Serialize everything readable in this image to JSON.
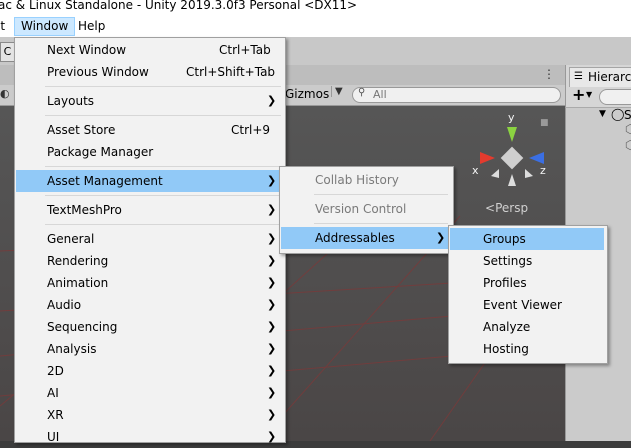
{
  "window": {
    "title": "ac & Linux Standalone - Unity 2019.3.0f3 Personal <DX11>"
  },
  "menubar": {
    "items": [
      {
        "label": "it"
      },
      {
        "label": "Window"
      },
      {
        "label": "Help"
      }
    ]
  },
  "toolbar": {
    "tool_glyph": "C"
  },
  "scene_view": {
    "gizmos_label": "Gizmos",
    "search_placeholder": "All",
    "persp_label": "Persp",
    "axis_x": "x",
    "axis_y": "y",
    "axis_z": "z",
    "colors": {
      "x_axis": "#e33b2e",
      "y_axis": "#8bd341",
      "z_axis": "#3b6fe3",
      "grid": "#7a3a3a"
    }
  },
  "hierarchy": {
    "tab_label": "Hierarch",
    "add_label": "+",
    "scene_initial": "S"
  },
  "window_menu": {
    "items": [
      {
        "label": "Next Window",
        "shortcut": "Ctrl+Tab"
      },
      {
        "label": "Previous Window",
        "shortcut": "Ctrl+Shift+Tab"
      },
      {
        "label": "Layouts",
        "submenu": true
      },
      {
        "label": "Asset Store",
        "shortcut": "Ctrl+9"
      },
      {
        "label": "Package Manager"
      },
      {
        "label": "Asset Management",
        "submenu": true,
        "highlighted": true
      },
      {
        "label": "TextMeshPro",
        "submenu": true
      },
      {
        "label": "General",
        "submenu": true
      },
      {
        "label": "Rendering",
        "submenu": true
      },
      {
        "label": "Animation",
        "submenu": true
      },
      {
        "label": "Audio",
        "submenu": true
      },
      {
        "label": "Sequencing",
        "submenu": true
      },
      {
        "label": "Analysis",
        "submenu": true
      },
      {
        "label": "2D",
        "submenu": true
      },
      {
        "label": "AI",
        "submenu": true
      },
      {
        "label": "XR",
        "submenu": true
      },
      {
        "label": "UI",
        "submenu": true
      }
    ]
  },
  "asset_management_menu": {
    "items": [
      {
        "label": "Collab History",
        "disabled": true
      },
      {
        "label": "Version Control",
        "disabled": true
      },
      {
        "label": "Addressables",
        "submenu": true,
        "highlighted": true
      }
    ]
  },
  "addressables_menu": {
    "items": [
      {
        "label": "Groups",
        "highlighted": true
      },
      {
        "label": "Settings"
      },
      {
        "label": "Profiles"
      },
      {
        "label": "Event Viewer"
      },
      {
        "label": "Analyze"
      },
      {
        "label": "Hosting"
      }
    ]
  },
  "icons": {
    "submenu_arrow": "chevron-right-icon",
    "more": "kebab-menu-icon",
    "lock": "lock-icon"
  }
}
